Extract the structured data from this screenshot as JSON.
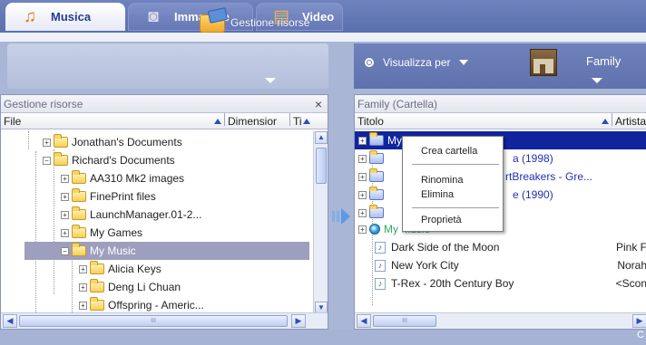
{
  "tabs": [
    {
      "label": "Musica",
      "icon": "music-notes-icon",
      "active": true
    },
    {
      "label": "Immagine",
      "icon": "camera-icon",
      "active": false
    },
    {
      "label": "Video",
      "icon": "film-icon",
      "active": false
    }
  ],
  "toolbar": {
    "resource_label": "Gestione risorse",
    "view_label": "Visualizza per",
    "family_label": "Family"
  },
  "left_panel": {
    "title": "Gestione risorse",
    "close_label": "×",
    "columns": [
      "File",
      "Dimensior",
      "Ti"
    ],
    "rows": [
      {
        "label": "Jonathan's Documents",
        "expander": "+"
      },
      {
        "label": "Richard's Documents",
        "expander": "−"
      },
      {
        "label": "AA310 Mk2 images",
        "expander": "+"
      },
      {
        "label": "FinePrint files",
        "expander": "+"
      },
      {
        "label": "LaunchManager.01-2...",
        "expander": "+"
      },
      {
        "label": "My Games",
        "expander": "+"
      },
      {
        "label": "My Music",
        "expander": "−",
        "selected": true
      },
      {
        "label": "Alicia Keys",
        "expander": "+"
      },
      {
        "label": "Deng Li Chuan",
        "expander": "+"
      },
      {
        "label": "Offspring - Americ...",
        "expander": "+"
      }
    ]
  },
  "right_panel": {
    "title": "Family (Cartella)",
    "columns": [
      "Titolo",
      "Artista"
    ],
    "rows": [
      {
        "label": "My Music",
        "kind": "folder",
        "selected": true
      },
      {
        "label": "a (1998)",
        "kind": "folder-link"
      },
      {
        "label": "rtBreakers - Gre...",
        "kind": "folder-link"
      },
      {
        "label": "e (1990)",
        "kind": "folder-link"
      },
      {
        "label": "",
        "kind": "folder"
      },
      {
        "label": "My Music",
        "kind": "web"
      },
      {
        "label": "Dark Side of the Moon",
        "artist": "Pink F",
        "kind": "track"
      },
      {
        "label": "New York City",
        "artist": "Norah",
        "kind": "track"
      },
      {
        "label": "T-Rex - 20th Century Boy",
        "artist": "<Scon",
        "kind": "track"
      }
    ]
  },
  "context_menu": {
    "items": [
      "Crea cartella",
      "Rinomina",
      "Elimina",
      "Proprietà"
    ]
  },
  "status": {
    "right": "C"
  },
  "colors": {
    "tabbar": "#5a6fae",
    "selection_left": "#9e9ebe",
    "selection_right": "#10249e",
    "link": "#2330b0"
  }
}
